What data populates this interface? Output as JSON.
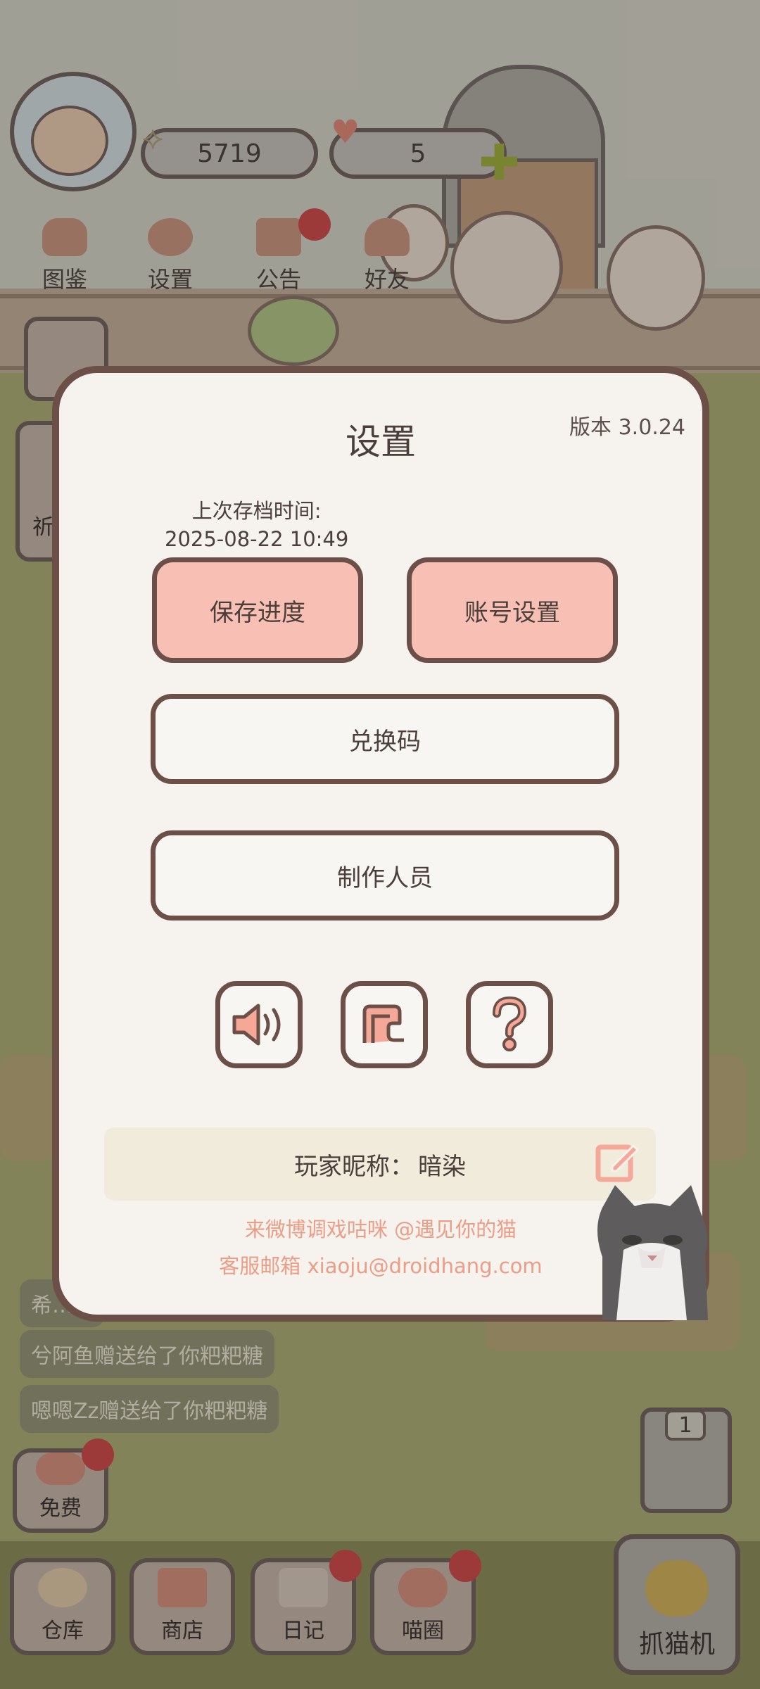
{
  "hud": {
    "fish_count": "5719",
    "heart_count": "5"
  },
  "top_nav": [
    {
      "label": "图鉴"
    },
    {
      "label": "设置"
    },
    {
      "label": "公告"
    },
    {
      "label": "好友"
    }
  ],
  "side_partial_label": "祈",
  "chat": [
    "希…",
    "兮阿鱼赠送给了你粑粑糖",
    "嗯嗯Zz赠送给了你粑粑糖"
  ],
  "free_label": "免费",
  "bottom_bar": [
    {
      "label": "仓库"
    },
    {
      "label": "商店"
    },
    {
      "label": "日记"
    },
    {
      "label": "喵圈"
    }
  ],
  "claw_machine": {
    "label": "抓猫机",
    "count": "1"
  },
  "settings": {
    "title": "设置",
    "version": "版本 3.0.24",
    "last_save_label": "上次存档时间:",
    "last_save_time": "2025-08-22 10:49",
    "save_button": "保存进度",
    "account_button": "账号设置",
    "redeem_button": "兑换码",
    "credits_button": "制作人员",
    "icons": [
      "sound-icon",
      "music-icon",
      "help-icon"
    ],
    "nickname_label": "玩家昵称：",
    "nickname": "暗染",
    "weibo_text": "来微博调戏咕咪 @遇见你的猫",
    "email_text": "客服邮箱 xiaoju@droidhang.com"
  },
  "colors": {
    "modal_bg": "#f6f3ef",
    "border": "#6c5048",
    "pink_button": "#f8c0b4",
    "footer_text": "#ec9d86"
  }
}
